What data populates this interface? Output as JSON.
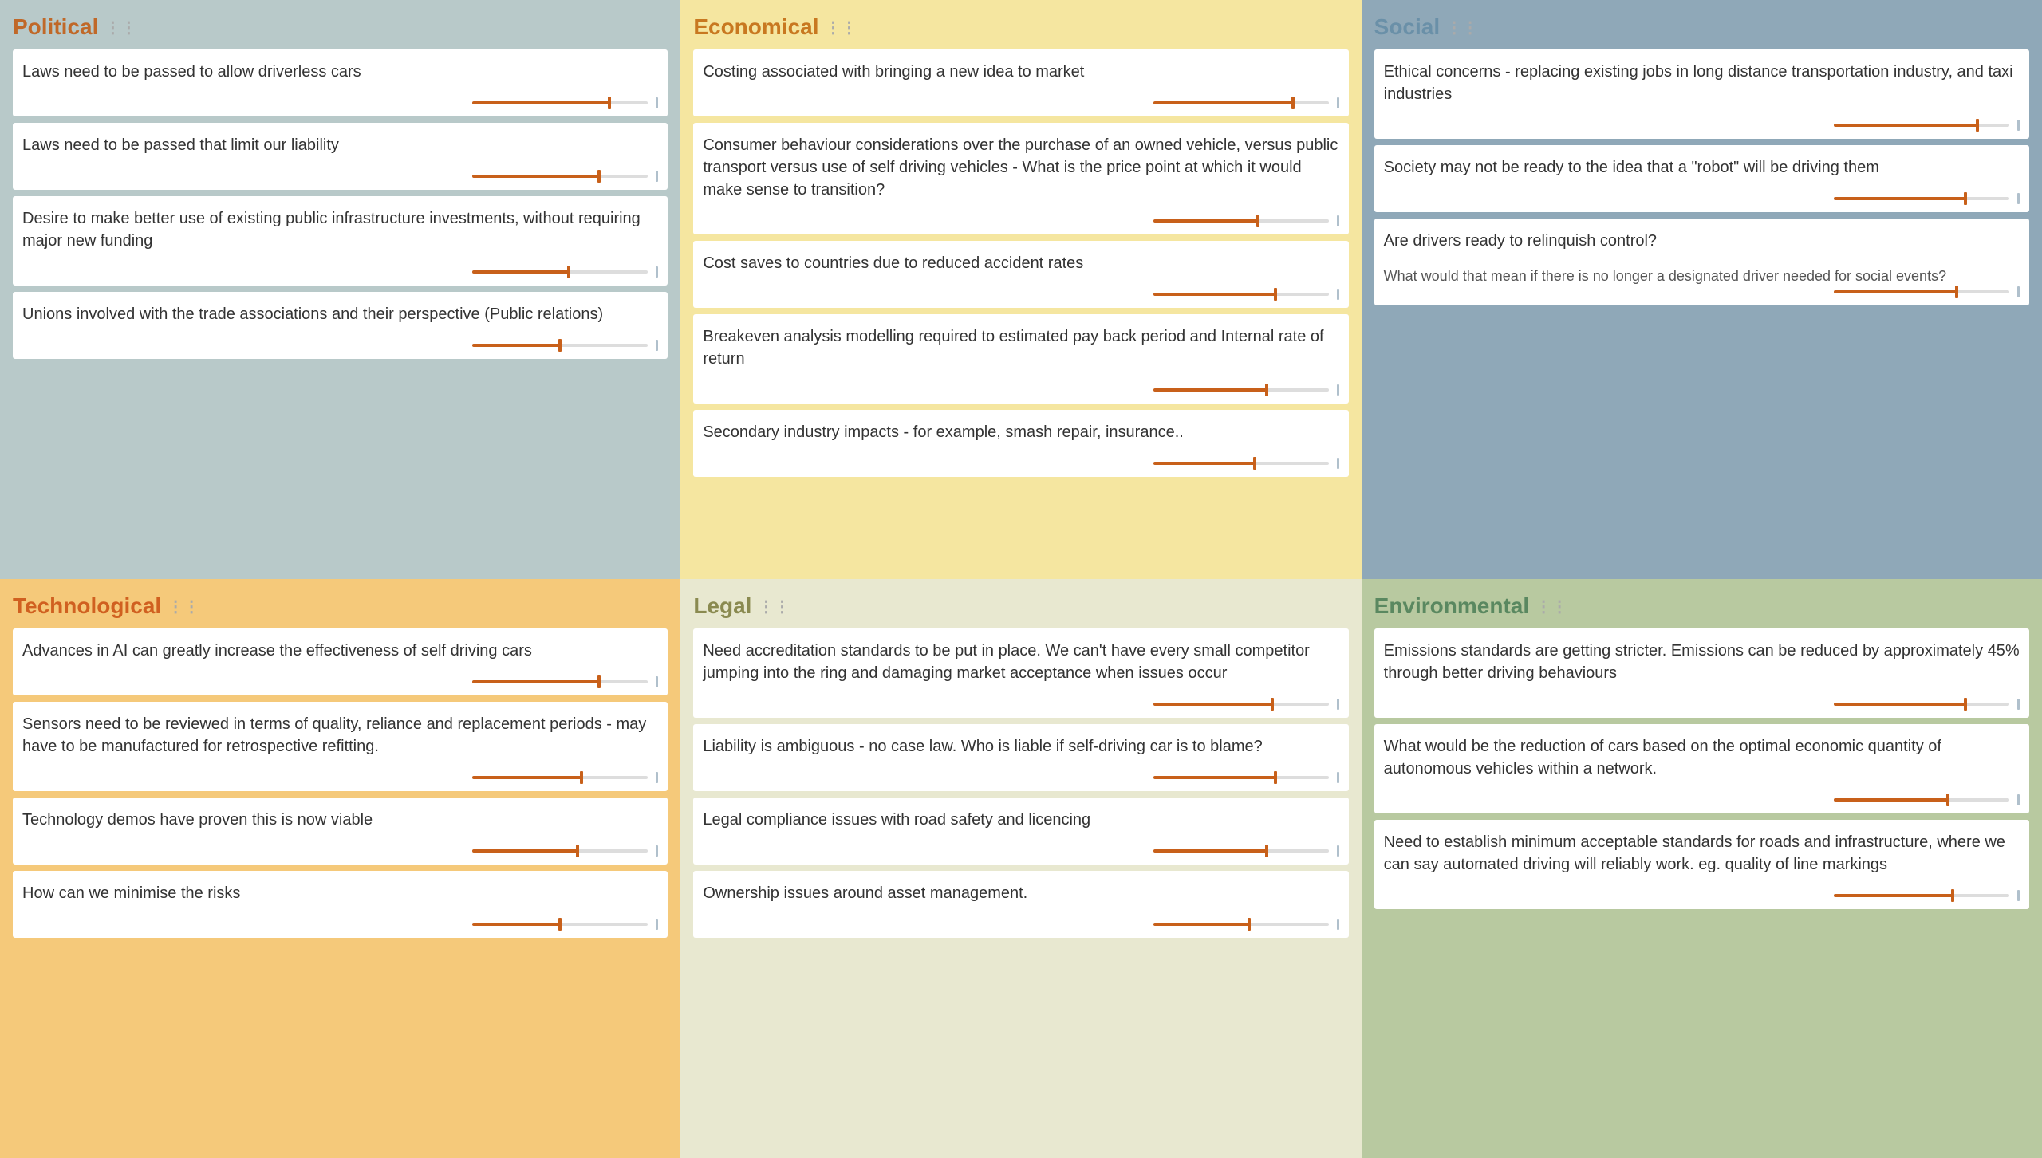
{
  "sections": [
    {
      "id": "political",
      "title": "Political",
      "class": "political",
      "titleColor": "#c06828",
      "cards": [
        {
          "text": "Laws need to be passed to allow driverless cars",
          "sliderPct": 78
        },
        {
          "text": "Laws need to be passed that limit our liability",
          "sliderPct": 72
        },
        {
          "text": "Desire to make better use of existing public infrastructure investments, without requiring major new funding",
          "sliderPct": 55
        },
        {
          "text": "Unions involved with the trade associations and their perspective (Public relations)",
          "sliderPct": 50
        }
      ]
    },
    {
      "id": "economical",
      "title": "Economical",
      "class": "economical",
      "titleColor": "#c87820",
      "cards": [
        {
          "text": "Costing associated with bringing a new idea to market",
          "sliderPct": 80
        },
        {
          "text": "Consumer behaviour considerations over the purchase of an owned vehicle, versus public transport versus use of self driving vehicles - What is the price point at which it would make sense to transition?",
          "sliderPct": 60
        },
        {
          "text": "Cost saves to countries due to reduced accident rates",
          "sliderPct": 70
        },
        {
          "text": "Breakeven analysis modelling required to estimated pay back period and Internal rate of return",
          "sliderPct": 65
        },
        {
          "text": "Secondary industry impacts - for example, smash repair, insurance..",
          "sliderPct": 58
        }
      ]
    },
    {
      "id": "social",
      "title": "Social",
      "class": "social",
      "titleColor": "#6a90a8",
      "cards": [
        {
          "text": "Ethical concerns - replacing existing jobs in long distance transportation industry, and taxi industries",
          "sliderPct": 82
        },
        {
          "text": "Society may not be ready to the idea that a \"robot\" will be driving them",
          "sliderPct": 75
        },
        {
          "text": "Are drivers ready to relinquish control?",
          "sliderPct": 70,
          "subtext": "What would that mean if there is no longer a designated driver needed for social events?"
        }
      ]
    },
    {
      "id": "technological",
      "title": "Technological",
      "class": "technological",
      "titleColor": "#d06020",
      "cards": [
        {
          "text": "Advances in AI can greatly increase the effectiveness of self driving cars",
          "sliderPct": 72
        },
        {
          "text": "Sensors need to be reviewed in terms of quality, reliance and replacement periods - may have to be manufactured for retrospective refitting.",
          "sliderPct": 62
        },
        {
          "text": "Technology demos have proven this is now viable",
          "sliderPct": 60
        },
        {
          "text": "How can we minimise the risks",
          "sliderPct": 50
        }
      ]
    },
    {
      "id": "legal",
      "title": "Legal",
      "class": "legal",
      "titleColor": "#8a8a50",
      "cards": [
        {
          "text": "Need accreditation standards to be put in place. We can't have every small competitor jumping into the ring and damaging market acceptance when issues occur",
          "sliderPct": 68
        },
        {
          "text": "Liability is ambiguous - no case law. Who is liable if self-driving car is to blame?",
          "sliderPct": 70
        },
        {
          "text": "Legal compliance issues with road safety and licencing",
          "sliderPct": 65
        },
        {
          "text": "Ownership issues around asset management.",
          "sliderPct": 55
        }
      ]
    },
    {
      "id": "environmental",
      "title": "Environmental",
      "class": "environmental",
      "titleColor": "#5a8860",
      "cards": [
        {
          "text": "Emissions standards are getting stricter. Emissions can be reduced by approximately 45% through better driving behaviours",
          "sliderPct": 75
        },
        {
          "text": "What would be the reduction of cars based on the optimal economic quantity of autonomous vehicles within a network.",
          "sliderPct": 65
        },
        {
          "text": "Need to establish minimum acceptable standards for roads and infrastructure, where we can say automated driving will reliably work. eg. quality of line markings",
          "sliderPct": 68
        }
      ]
    }
  ],
  "labels": {
    "drag_icon": "⠿"
  }
}
